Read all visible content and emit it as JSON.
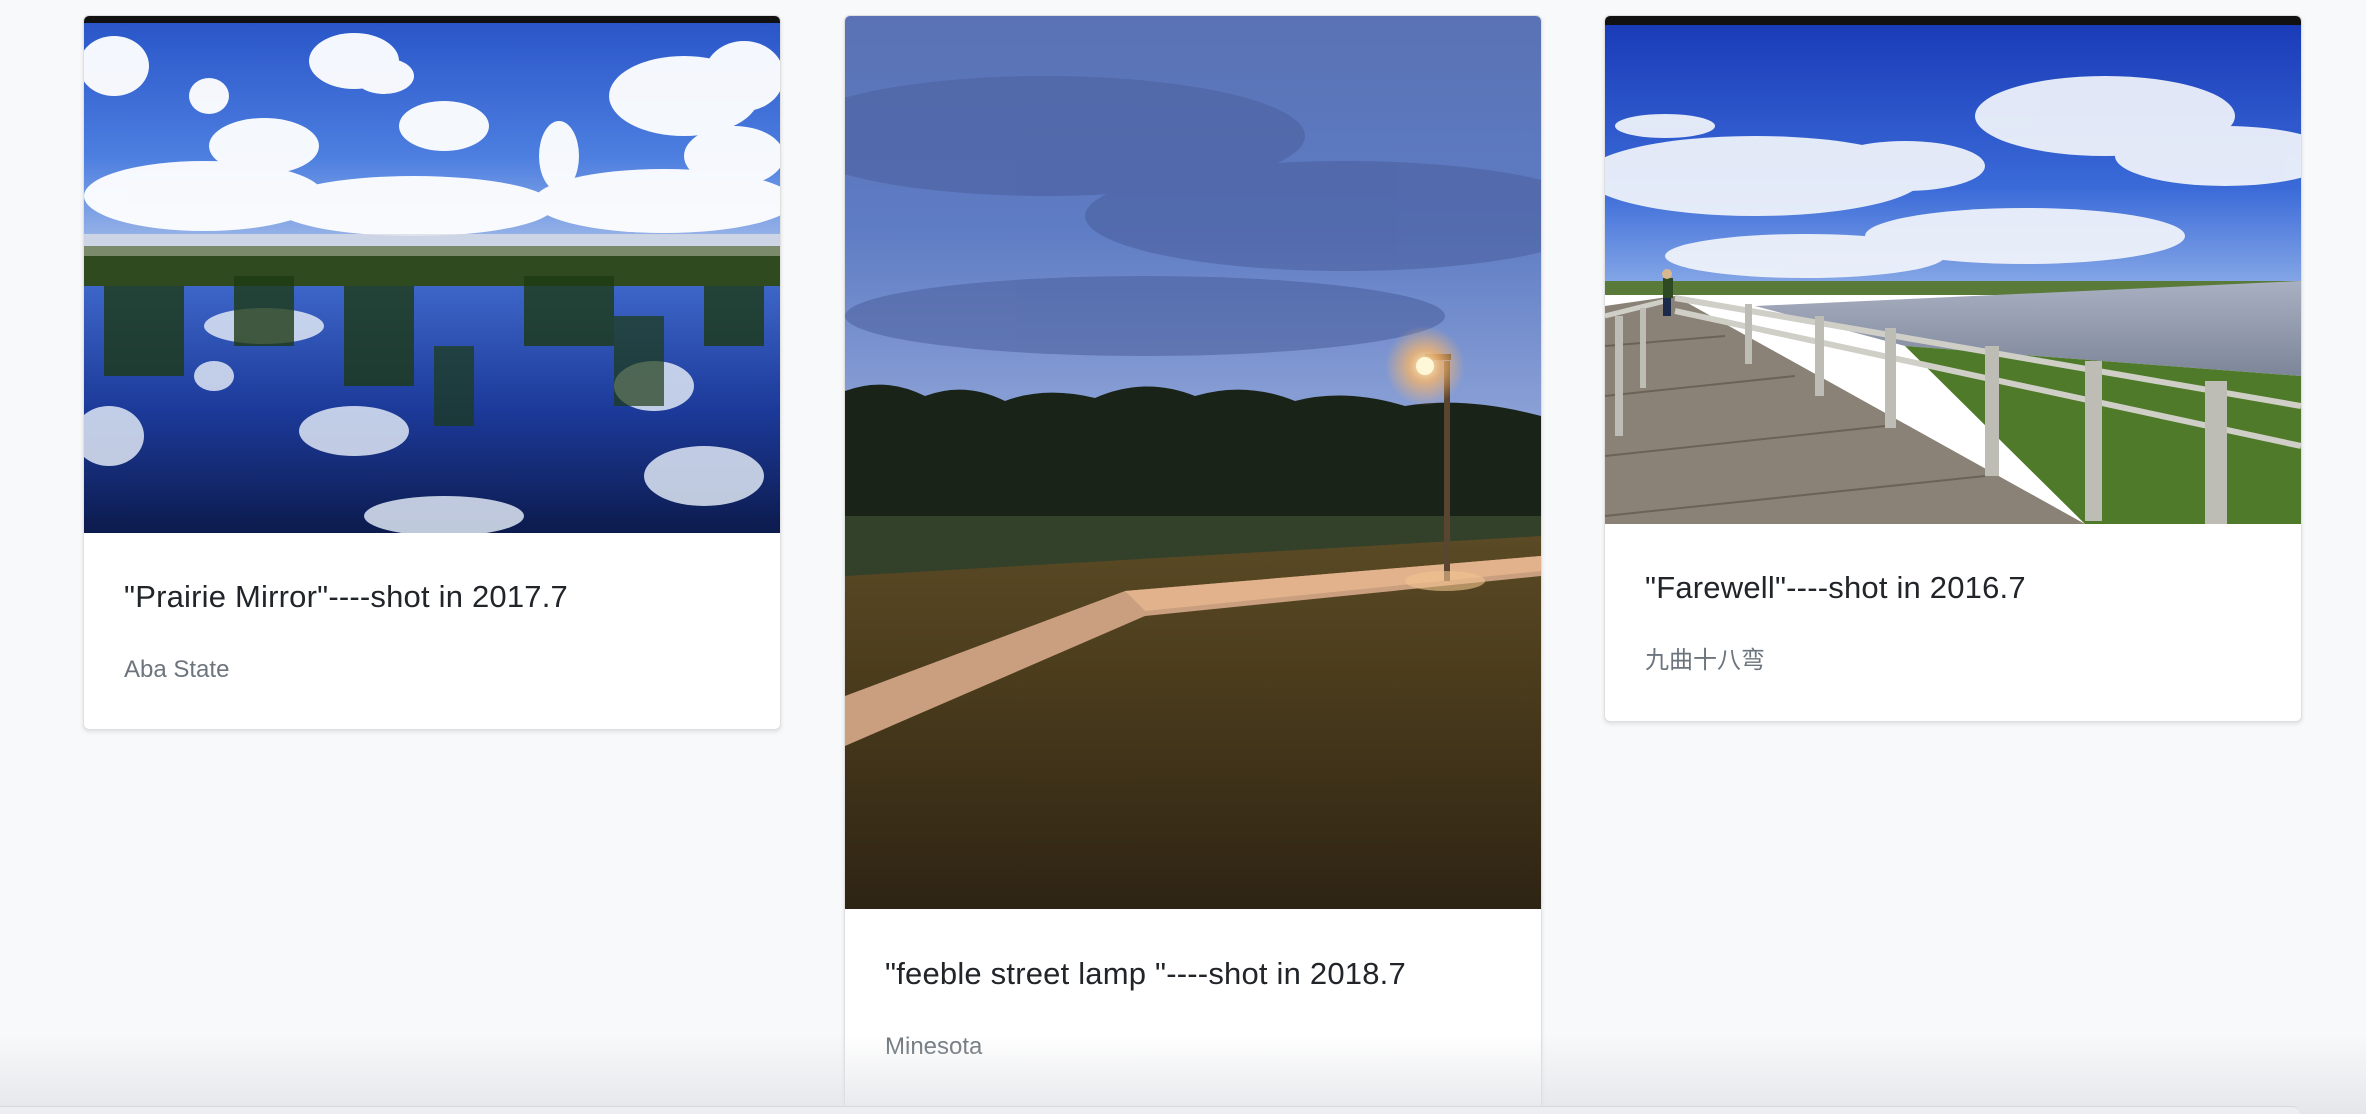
{
  "cards": [
    {
      "title": "\"Prairie Mirror\"----shot in 2017.7",
      "location": "Aba State",
      "image": "prairie-lake-reflection-photo"
    },
    {
      "title": "\"feeble street lamp \"----shot in 2018.7",
      "location": "Minesota",
      "image": "street-lamp-dusk-photo"
    },
    {
      "title": "\"Farewell\"----shot in 2016.7",
      "location": "九曲十八弯",
      "image": "wooden-boardwalk-photo"
    }
  ],
  "colors": {
    "page_background": "#f8f9fa",
    "title_text": "#212529",
    "muted_text": "#6c757d"
  }
}
